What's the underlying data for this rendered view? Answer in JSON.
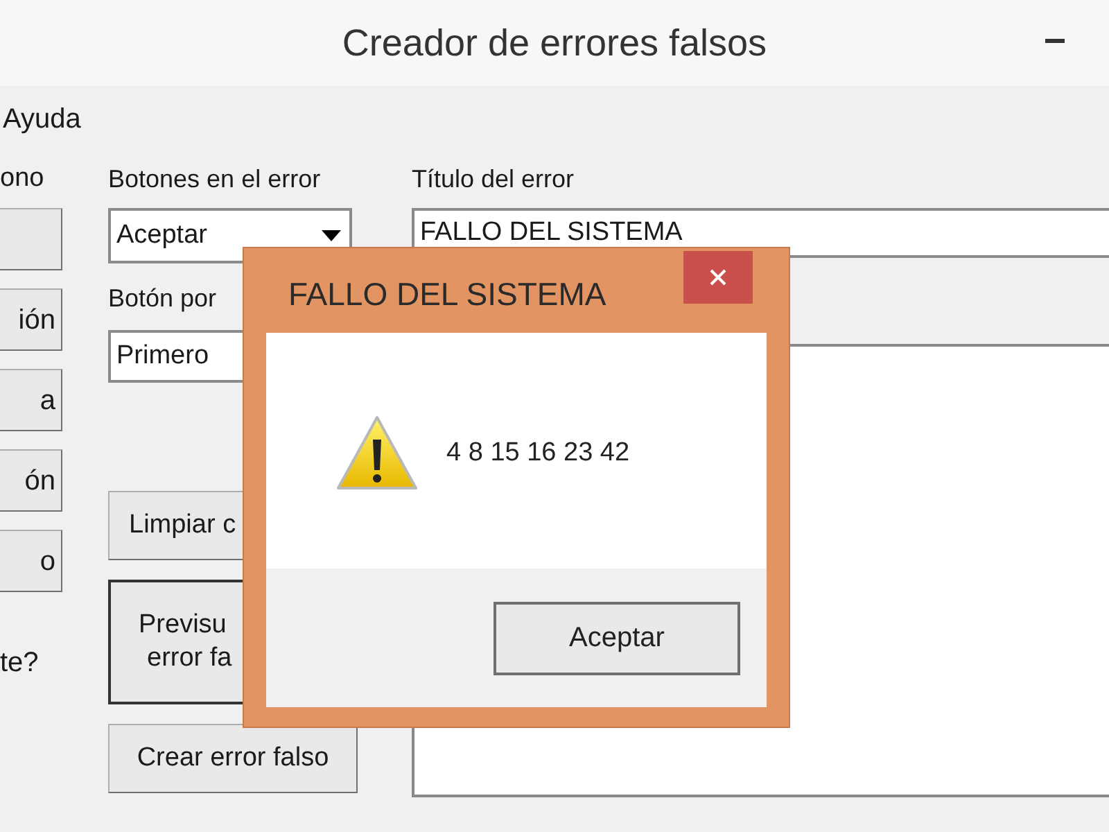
{
  "window": {
    "title": "Creador de errores falsos"
  },
  "menu": [
    "Ayuda"
  ],
  "left_column": {
    "label": "ono",
    "buttons": [
      {
        "kind": "blank"
      },
      {
        "kind": "text",
        "label": "ión"
      },
      {
        "kind": "text",
        "label": "a"
      },
      {
        "kind": "text",
        "label": "ón"
      },
      {
        "kind": "text",
        "label": "o"
      }
    ],
    "question": "te?"
  },
  "error_buttons": {
    "label": "Botones en el error",
    "value": "Aceptar"
  },
  "default_button": {
    "label": "Botón por",
    "value": "Primero"
  },
  "clear_button": "Limpiar c",
  "preview_button": [
    "Previsu",
    "error fa"
  ],
  "create_button": "Crear error falso",
  "title_field": {
    "label": "Título del error",
    "value": "FALLO DEL SISTEMA"
  },
  "dialog": {
    "title": "FALLO DEL SISTEMA",
    "message": "4 8 15 16 23 42",
    "button": "Aceptar"
  }
}
